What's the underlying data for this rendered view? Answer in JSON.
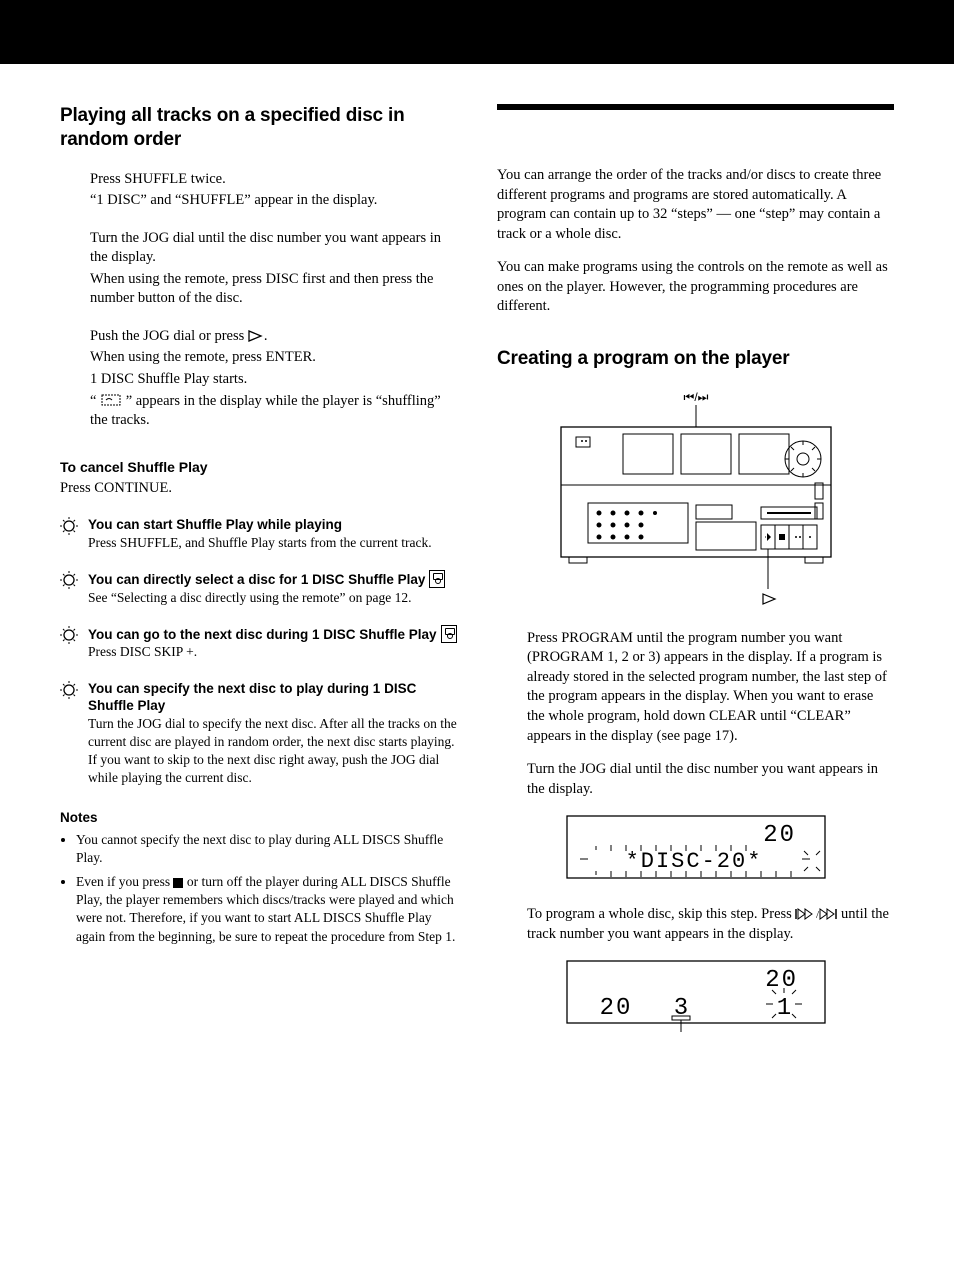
{
  "left": {
    "title": "Playing all tracks on a specified disc in random order",
    "step1_l1": "Press SHUFFLE twice.",
    "step1_l2": "“1 DISC” and “SHUFFLE” appear in the display.",
    "step2_l1": "Turn the JOG dial until the disc number you want appears in the display.",
    "step2_l2": "When using the remote, press DISC first and then press the number button of the disc.",
    "step3_pre": "Push the JOG dial or press ",
    "step3_post": ".",
    "step3_l2": "When using the remote, press ENTER.",
    "step3_l3": "1 DISC Shuffle Play starts.",
    "step3_l4a": "“",
    "step3_l4b": "” appears in the display while the player is “shuffling” the tracks.",
    "cancel_title": "To cancel Shuffle Play",
    "cancel_body": "Press CONTINUE.",
    "tip1_title": "You can start Shuffle Play while playing",
    "tip1_body": "Press SHUFFLE, and Shuffle Play starts from the current track.",
    "tip2_title": "You can directly select a disc for 1 DISC Shuffle Play",
    "tip2_body": "See “Selecting a disc directly using the remote” on page 12.",
    "tip3_title": "You can go to the next disc during 1 DISC Shuffle Play",
    "tip3_body": "Press DISC SKIP +.",
    "tip4_title": "You can specify the next disc to play during 1 DISC Shuffle Play",
    "tip4_body": "Turn the JOG dial to specify the next disc. After all the tracks on the current disc are played in random order, the next disc starts playing. If you want to skip to the next disc right away, push the JOG dial while playing the current disc.",
    "notes_title": "Notes",
    "note1": "You cannot specify the next disc to play during ALL DISCS Shuffle Play.",
    "note2_pre": "Even if you press ",
    "note2_post": " or turn off the player during ALL DISCS Shuffle Play, the player remembers which discs/tracks were played and which were not. Therefore, if you want to start ALL DISCS Shuffle Play again from the beginning, be sure to repeat the procedure from Step 1."
  },
  "right": {
    "intro1": "You can arrange the order of the tracks and/or discs to create three different programs and programs are stored automatically. A program can contain up to 32 “steps” — one “step” may contain a track or a whole disc.",
    "intro2": "You can make programs using the controls on the remote as well as ones on the player. However, the programming procedures are different.",
    "title": "Creating a program on the player",
    "diagram_top_label": "⏮/⏭",
    "diagram_bottom_label": "▷",
    "step1": "Press PROGRAM until the program number you want (PROGRAM 1, 2 or 3) appears in the display. If a program is already stored in the selected program number, the last step of the program appears in the display. When you want to erase the whole program, hold down CLEAR until “CLEAR” appears in the display (see page 17).",
    "step2": "Turn the JOG dial until the disc number you want appears in the display.",
    "display1_num": "20",
    "display1_text": "*DISC-20*",
    "step3_pre": "To program a whole disc, skip this step. Press ",
    "step3_post": " until the track number you want appears in the display.",
    "display2_left": "20",
    "display2_mid": "3",
    "display2_right_top": "20",
    "display2_right_bottom": "1"
  }
}
